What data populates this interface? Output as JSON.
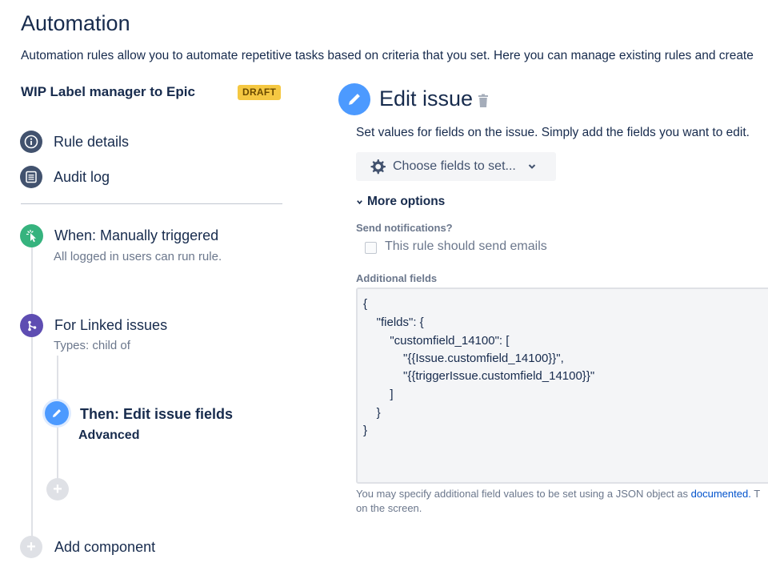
{
  "page": {
    "title": "Automation",
    "description": "Automation rules allow you to automate repetitive tasks based on criteria that you set. Here you can manage existing rules and create"
  },
  "rule": {
    "name": "WIP Label manager to Epic",
    "status_badge": "DRAFT"
  },
  "nav": {
    "rule_details": "Rule details",
    "audit_log": "Audit log"
  },
  "steps": {
    "trigger": {
      "title": "When: Manually triggered",
      "subtitle": "All logged in users can run rule."
    },
    "branch": {
      "title": "For Linked issues",
      "subtitle": "Types: child of"
    },
    "action": {
      "title": "Then: Edit issue fields",
      "subtitle": "Advanced"
    },
    "add_component": "Add component"
  },
  "editor": {
    "title": "Edit issue",
    "description": "Set values for fields on the issue. Simply add the fields you want to edit.",
    "choose_fields_label": "Choose fields to set...",
    "more_options_label": "More options",
    "send_notifications_label": "Send notifications?",
    "send_emails_checkbox_label": "This rule should send emails",
    "send_emails_checked": false,
    "additional_fields_label": "Additional fields",
    "json_lines": [
      "{",
      "    \"fields\": {",
      "        \"customfield_14100\": [",
      "            \"{{Issue.customfield_14100}}\",",
      "            \"{{triggerIssue.customfield_14100}}\"",
      "        ]",
      "    }",
      "}"
    ],
    "help_text_prefix": "You may specify additional field values to be set using a JSON object as ",
    "help_link": "documented.",
    "help_text_suffix": " T",
    "help_text_line2": "on the screen."
  },
  "colors": {
    "info_icon_bg": "#42526e",
    "trigger_green": "#36b37e",
    "branch_purple": "#5e4db2",
    "action_blue": "#4c9aff",
    "draft_yellow": "#f5c842",
    "link_blue": "#0052cc"
  }
}
